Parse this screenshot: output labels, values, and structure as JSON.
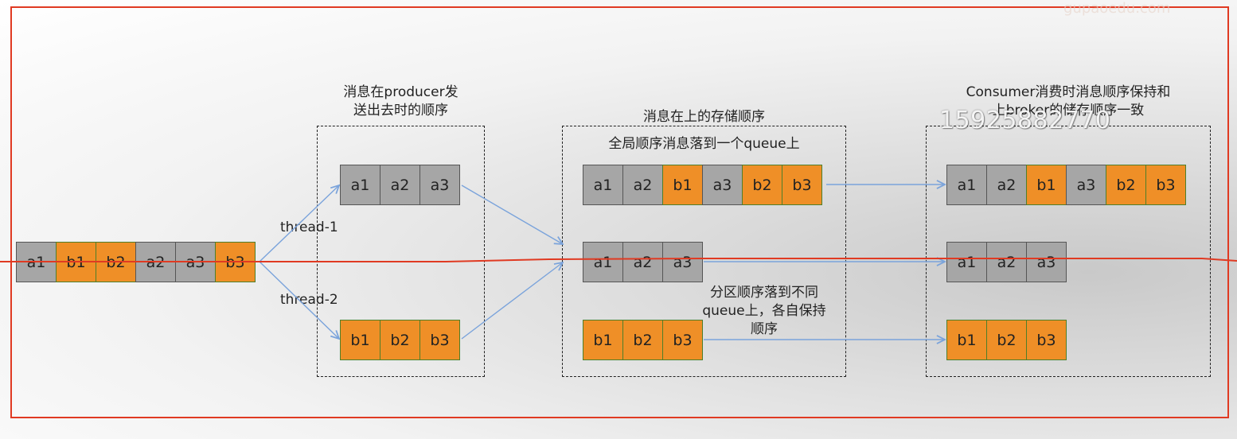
{
  "labels": {
    "producer_order": "消息在producer发\n送出去时的顺序",
    "storage_order": "消息在上的存储顺序",
    "global_order": "全局顺序消息落到一个queue上",
    "consumer_order": "Consumer消费时消息顺序保持和\n上broker的储存顺序一致",
    "partition_order": "分区顺序落到不同\nqueue上，各自保持\n顺序",
    "thread1": "thread-1",
    "thread2": "thread-2"
  },
  "watermark": "15925882770",
  "logo_watermark": "gupaoedu.com",
  "rows": {
    "source": [
      "a1",
      "b1",
      "b2",
      "a2",
      "a3",
      "b3"
    ],
    "thread1": [
      "a1",
      "a2",
      "a3"
    ],
    "thread2": [
      "b1",
      "b2",
      "b3"
    ],
    "broker_global": [
      "a1",
      "a2",
      "b1",
      "a3",
      "b2",
      "b3"
    ],
    "broker_partition_a": [
      "a1",
      "a2",
      "a3"
    ],
    "broker_partition_b": [
      "b1",
      "b2",
      "b3"
    ],
    "consumer_global": [
      "a1",
      "a2",
      "b1",
      "a3",
      "b2",
      "b3"
    ],
    "consumer_partition_a": [
      "a1",
      "a2",
      "a3"
    ],
    "consumer_partition_b": [
      "b1",
      "b2",
      "b3"
    ]
  },
  "colors": {
    "a_fill": "#a6a6a6",
    "b_fill": "#ef8f27",
    "arrow": "#7aa3db",
    "frame": "#e03a22"
  }
}
